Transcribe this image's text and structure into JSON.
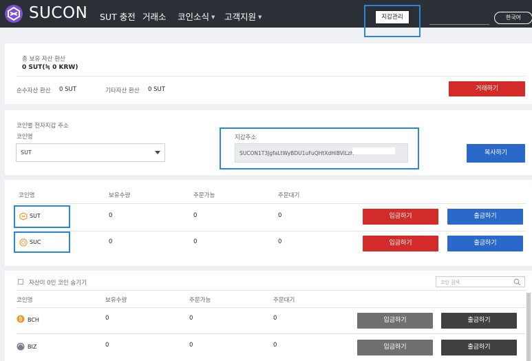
{
  "header": {
    "logo_text": "SUCON",
    "nav": [
      {
        "label": "SUT 충전"
      },
      {
        "label": "거래소"
      },
      {
        "label": "코인소식"
      },
      {
        "label": "고객지원"
      }
    ],
    "wallet_button": "지갑관리",
    "language_button": "한국어"
  },
  "summary": {
    "title": "총 보유 자산 환산",
    "total": "0 SUT(≒ 0 KRW)",
    "pure_label": "순수자산 환산",
    "pure_value": "0 SUT",
    "other_label": "기타자산 환산",
    "other_value": "0 SUT",
    "trade_button": "거래하기"
  },
  "wallet_address": {
    "section_title": "코인별 전자지갑 주소",
    "coin_label": "코인명",
    "selected_coin": "SUT",
    "address_label": "지갑주소",
    "address_value": "SUCON1T3JgfaLtWyBDU1uFuQHtXdHiBViLzH",
    "copy_button": "복사하기"
  },
  "my_coins": {
    "headers": [
      "코인명",
      "보유수량",
      "주문가능",
      "주문대기"
    ],
    "rows": [
      {
        "name": "SUT",
        "holdings": "0",
        "available": "0",
        "pending": "0",
        "deposit": "입금하기",
        "withdraw": "출금하기"
      },
      {
        "name": "SUC",
        "holdings": "0",
        "available": "0",
        "pending": "0",
        "deposit": "입금하기",
        "withdraw": "출금하기"
      }
    ]
  },
  "other_coins": {
    "hide_zero_label": "자산이 0인 코인 숨기기",
    "search_placeholder": "코인 검색",
    "headers": [
      "코인명",
      "보유수량",
      "주문가능",
      "주문대기"
    ],
    "rows": [
      {
        "name": "BCH",
        "holdings": "0",
        "available": "0",
        "pending": "0",
        "deposit": "입금하기",
        "withdraw": "출금하기"
      },
      {
        "name": "BIZ",
        "holdings": "0",
        "available": "0",
        "pending": "0",
        "deposit": "입금하기",
        "withdraw": "출금하기"
      }
    ]
  },
  "colors": {
    "header_bg": "#2b2f36",
    "highlight_border": "#2b86d6",
    "red_button": "#d32a2a",
    "blue_button": "#2a68c9",
    "gray_button": "#707070",
    "dark_button": "#404040",
    "sut_icon": "#e8a34a",
    "suc_icon": "#e8a34a",
    "bch_icon": "#e89a2c",
    "biz_icon": "#7a8089"
  },
  "icons": [
    "sucon-logo-icon",
    "chevron-down-icon",
    "search-icon",
    "sut-coin-icon",
    "suc-coin-icon",
    "bch-coin-icon",
    "biz-coin-icon"
  ]
}
